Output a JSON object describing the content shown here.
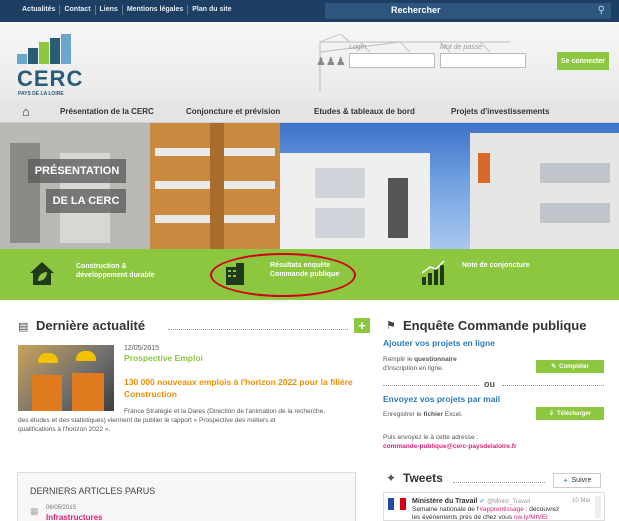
{
  "topnav": {
    "items": [
      "Actualités",
      "Contact",
      "Liens",
      "Mentions légales",
      "Plan du site"
    ],
    "search_label": "Rechercher"
  },
  "header": {
    "logo_text": "CERC",
    "logo_subtitle": "PAYS DE LA LOIRE",
    "login_label": "Login",
    "password_label": "Mot de passe",
    "connect_button": "Se connecter"
  },
  "mainnav": {
    "items": [
      "Présentation de la CERC",
      "Conjoncture et prévision",
      "Etudes & tableaux de bord",
      "Projets d'investissements"
    ]
  },
  "banner": {
    "line1": "PRÉSENTATION",
    "line2": "DE LA CERC"
  },
  "green_band": {
    "item1": {
      "line1": "Construction &",
      "line2": "développement durable"
    },
    "item2": {
      "line1": "Résultats enquête",
      "line2": "Commande publique"
    },
    "item3": {
      "line1": "Note de conjoncture"
    }
  },
  "news": {
    "title": "Dernière actualité",
    "date": "12/05/2015",
    "category": "Prospective Emploi",
    "headline": "130 000 nouveaux emplois à l'horizon 2022 pour la filière Construction",
    "body1": "France Stratégie et la Dares (Direction de l'animation de la recherche,",
    "body2": "des études et des statistiques) viennent de publier le rapport « Prospective des métiers et",
    "body3": "qualifications à l'horizon 2022 »."
  },
  "articles": {
    "title": "DERNIERS ARTICLES PARUS",
    "date": "06/05/2015",
    "category": "Infrastructures"
  },
  "survey": {
    "title": "Enquête Commande publique",
    "add_title": "Ajouter vos projets en ligne",
    "add_text1_pre": "Remplir le ",
    "add_text1_bold": "questionnaire",
    "add_text2": "d'inscription en ligne.",
    "complete_button": "Compléter",
    "or": "ou",
    "mail_title": "Envoyez vos projets par mail",
    "mail_text_pre": "Enregistrer le ",
    "mail_text_bold": "fichier",
    "mail_text_post": " Excel.",
    "download_button": "Télécharger",
    "send_text": "Puis envoyez le à cette adresse :",
    "email": "commande-publique@cerc-paysdelaloire.fr"
  },
  "tweets": {
    "title": "Tweets",
    "follow_button": "Suivre",
    "author": "Ministère du Travail",
    "handle": "@Minist_Travail",
    "date": "10 Mai",
    "text1_pre": "Semaine nationale de l'",
    "text1_tag": "#apprentissage",
    "text1_post": " : découvrez",
    "text2_pre": "les événements près de chez vous ",
    "text2_link": "ow.ly/MtVEt"
  },
  "colors": {
    "navy": "#1d3f63",
    "green": "#8dc63f",
    "orange": "#f08c00",
    "magenta": "#d6247a",
    "red_circle": "#d0021b"
  }
}
